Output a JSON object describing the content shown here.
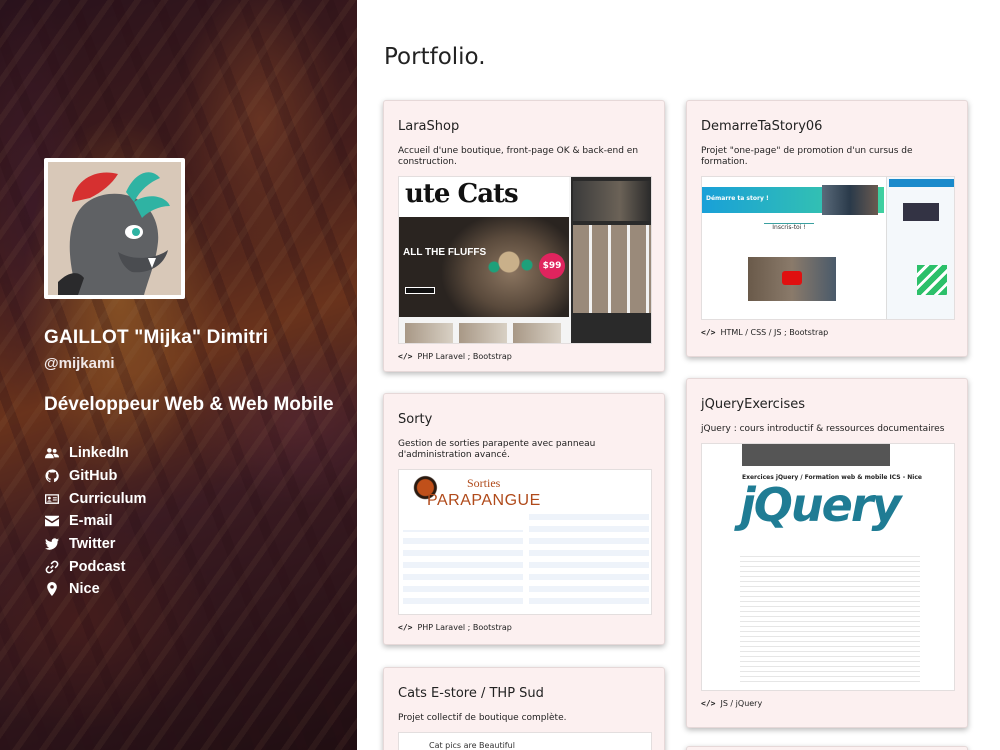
{
  "profile": {
    "name": "GAILLOT \"Mijka\" Dimitri",
    "handle": "@mijkami",
    "role": "Développeur Web & Web Mobile"
  },
  "links": [
    {
      "label": "LinkedIn",
      "icon": "users-icon"
    },
    {
      "label": "GitHub",
      "icon": "github-icon"
    },
    {
      "label": "Curriculum",
      "icon": "id-card-icon"
    },
    {
      "label": "E-mail",
      "icon": "envelope-icon"
    },
    {
      "label": "Twitter",
      "icon": "twitter-icon"
    },
    {
      "label": "Podcast",
      "icon": "link-icon"
    },
    {
      "label": "Nice",
      "icon": "map-marker-icon"
    }
  ],
  "main": {
    "title": "Portfolio."
  },
  "projects": [
    {
      "title": "LaraShop",
      "description": "Accueil d'une boutique, front-page OK & back-end en construction.",
      "tech": "PHP Laravel ; Bootstrap",
      "preview": {
        "logo": "ute Cats",
        "headline": "ALL THE FLUFFS",
        "price": "$99"
      }
    },
    {
      "title": "DemarreTaStory06",
      "description": "Projet \"one-page\" de promotion d'un cursus de formation.",
      "tech": "HTML / CSS / JS ; Bootstrap",
      "preview": {
        "banner": "Démarre ta story !",
        "cta": "Inscris-toi !"
      }
    },
    {
      "title": "Sorty",
      "description": "Gestion de sorties parapente avec panneau d'administration avancé.",
      "tech": "PHP Laravel ; Bootstrap",
      "preview": {
        "brand_top": "Sorties",
        "brand_bottom": "PARAPANGUE"
      }
    },
    {
      "title": "jQueryExercises",
      "description": "jQuery : cours introductif & ressources documentaires",
      "tech": "JS / jQuery",
      "preview": {
        "header": "Exercices jQuery / Formation web & mobile ICS - Nice",
        "logo": "jQuery"
      }
    },
    {
      "title": "Cats E-store / THP Sud",
      "description": "Projet collectif de boutique complète.",
      "tech": "",
      "preview": {
        "text": "Cat pics are Beautiful"
      }
    }
  ],
  "colors": {
    "card_bg": "#fcf0f0",
    "sidebar_text": "#ffffff",
    "jquery_blue": "#1f7c94",
    "sorty_brand": "#b04a1a"
  }
}
